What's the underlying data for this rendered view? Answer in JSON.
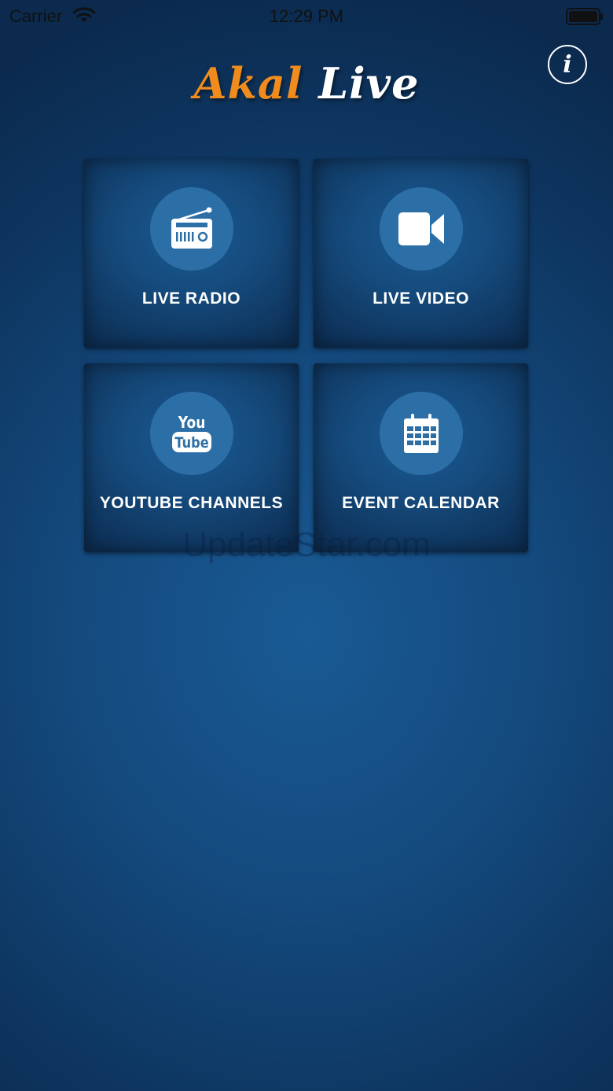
{
  "status_bar": {
    "carrier": "Carrier",
    "time": "12:29 PM"
  },
  "header": {
    "title_part1": "Akal",
    "title_part2": "Live",
    "info_glyph": "i"
  },
  "tiles": [
    {
      "label": "LIVE RADIO",
      "icon": "radio-icon"
    },
    {
      "label": "LIVE VIDEO",
      "icon": "video-camera-icon"
    },
    {
      "label": "YOUTUBE CHANNELS",
      "icon": "youtube-icon",
      "icon_text_top": "You",
      "icon_text_bottom": "Tube"
    },
    {
      "label": "EVENT CALENDAR",
      "icon": "calendar-icon"
    }
  ],
  "watermark": "UpdateStar.com",
  "colors": {
    "accent_orange": "#f08c1e",
    "background_blue": "#144a7e",
    "icon_circle": "#2c6fa6"
  }
}
